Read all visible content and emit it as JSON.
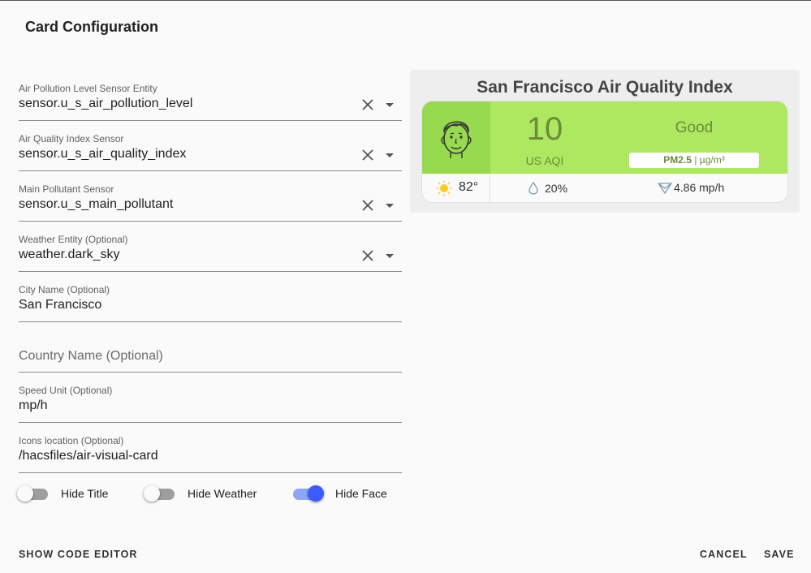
{
  "dialog": {
    "title": "Card Configuration"
  },
  "fields": [
    {
      "label": "Air Pollution Level Sensor Entity",
      "value": "sensor.u_s_air_pollution_level"
    },
    {
      "label": "Air Quality Index Sensor",
      "value": "sensor.u_s_air_quality_index"
    },
    {
      "label": "Main Pollutant Sensor",
      "value": "sensor.u_s_main_pollutant"
    },
    {
      "label": "Weather Entity (Optional)",
      "value": "weather.dark_sky"
    },
    {
      "label": "City Name (Optional)",
      "value": "San Francisco"
    },
    {
      "placeholder": "Country Name (Optional)",
      "value": ""
    },
    {
      "label": "Speed Unit (Optional)",
      "value": "mp/h"
    },
    {
      "label": "Icons location (Optional)",
      "value": "/hacsfiles/air-visual-card"
    }
  ],
  "toggles": [
    {
      "label": "Hide Title",
      "on": false
    },
    {
      "label": "Hide Weather",
      "on": false
    },
    {
      "label": "Hide Face",
      "on": true
    }
  ],
  "footer": {
    "code_editor": "SHOW CODE EDITOR",
    "cancel": "CANCEL",
    "save": "SAVE"
  },
  "preview": {
    "title": "San Francisco Air Quality Index",
    "aqi_value": "10",
    "aqi_unit": "US AQI",
    "aqi_status": "Good",
    "pollutant_name": "PM2.5",
    "pollutant_unit": "µg/m³",
    "temperature": "82°",
    "humidity": "20%",
    "wind": "4.86 mp/h",
    "colors": {
      "card_green": "#aee861",
      "face_green": "#97d94f",
      "text_green": "#6c8a3a",
      "toggle_accent": "#3d5afe"
    }
  }
}
